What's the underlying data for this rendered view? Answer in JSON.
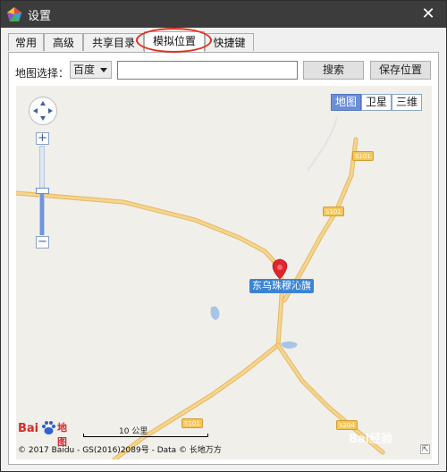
{
  "window": {
    "title": "设置",
    "close_glyph": "✕",
    "icon": "app-pentagon-icon"
  },
  "tabs": [
    {
      "label": "常用",
      "active": false
    },
    {
      "label": "高级",
      "active": false
    },
    {
      "label": "共享目录",
      "active": false
    },
    {
      "label": "模拟位置",
      "active": true
    },
    {
      "label": "快捷键",
      "active": false
    }
  ],
  "location": {
    "map_select_label": "地图选择：",
    "map_provider": "百度",
    "search_value": "",
    "search_button": "搜索",
    "save_button": "保存位置"
  },
  "map": {
    "type_buttons": [
      {
        "label": "地图",
        "active": true
      },
      {
        "label": "卫星",
        "active": false
      },
      {
        "label": "三维",
        "active": false
      }
    ],
    "zoom_in": "+",
    "zoom_out": "−",
    "marker_label": "东乌珠穆沁旗",
    "road_labels": [
      "S101",
      "S101",
      "S101",
      "S204"
    ],
    "logo_text": "Bai地图",
    "scale_label": "10 公里",
    "copyright": "© 2017 Baidu - GS(2016)2089号 - Data © 长地万方",
    "watermark": "Bai经验",
    "expand_glyph": "⇱"
  },
  "colors": {
    "titlebar": "#3c3c3c",
    "road": "#f6d58a",
    "road_edge": "#e2b868",
    "marker": "#e0262b",
    "label_bg": "#3b84d4",
    "water": "#a8c4e6",
    "highlight_ring": "#e0301e"
  }
}
